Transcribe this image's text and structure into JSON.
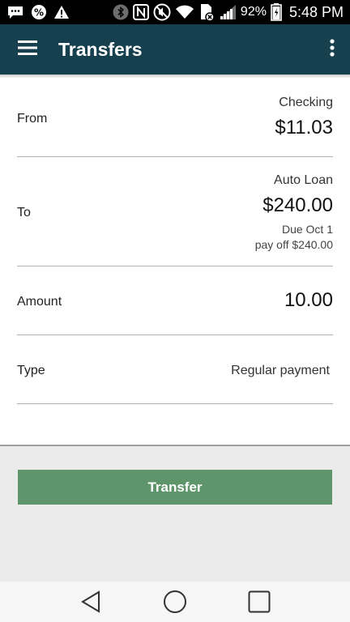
{
  "status_bar": {
    "battery_percent": "92%",
    "time": "5:48 PM",
    "icons": [
      "message-icon",
      "percent-icon",
      "warning-icon",
      "bluetooth-icon",
      "nfc-icon",
      "mute-icon",
      "wifi-icon",
      "sim-error-icon",
      "signal-icon",
      "battery-charging-icon"
    ]
  },
  "app_bar": {
    "title": "Transfers",
    "menu_icon": "hamburger-menu-icon",
    "more_icon": "more-vertical-icon"
  },
  "form": {
    "from": {
      "label": "From",
      "account": "Checking",
      "amount": "$11.03"
    },
    "to": {
      "label": "To",
      "account": "Auto Loan",
      "amount": "$240.00",
      "due": "Due Oct 1",
      "payoff": "pay off $240.00"
    },
    "amount": {
      "label": "Amount",
      "value": "10.00"
    },
    "type": {
      "label": "Type",
      "value": "Regular payment"
    }
  },
  "transfer_button": {
    "label": "Transfer",
    "color": "#5e956a"
  },
  "nav_bar": {
    "icons": [
      "back-icon",
      "home-icon",
      "recents-icon"
    ]
  },
  "colors": {
    "app_bar": "#17404f",
    "button": "#5e956a",
    "background": "#ebebeb"
  }
}
